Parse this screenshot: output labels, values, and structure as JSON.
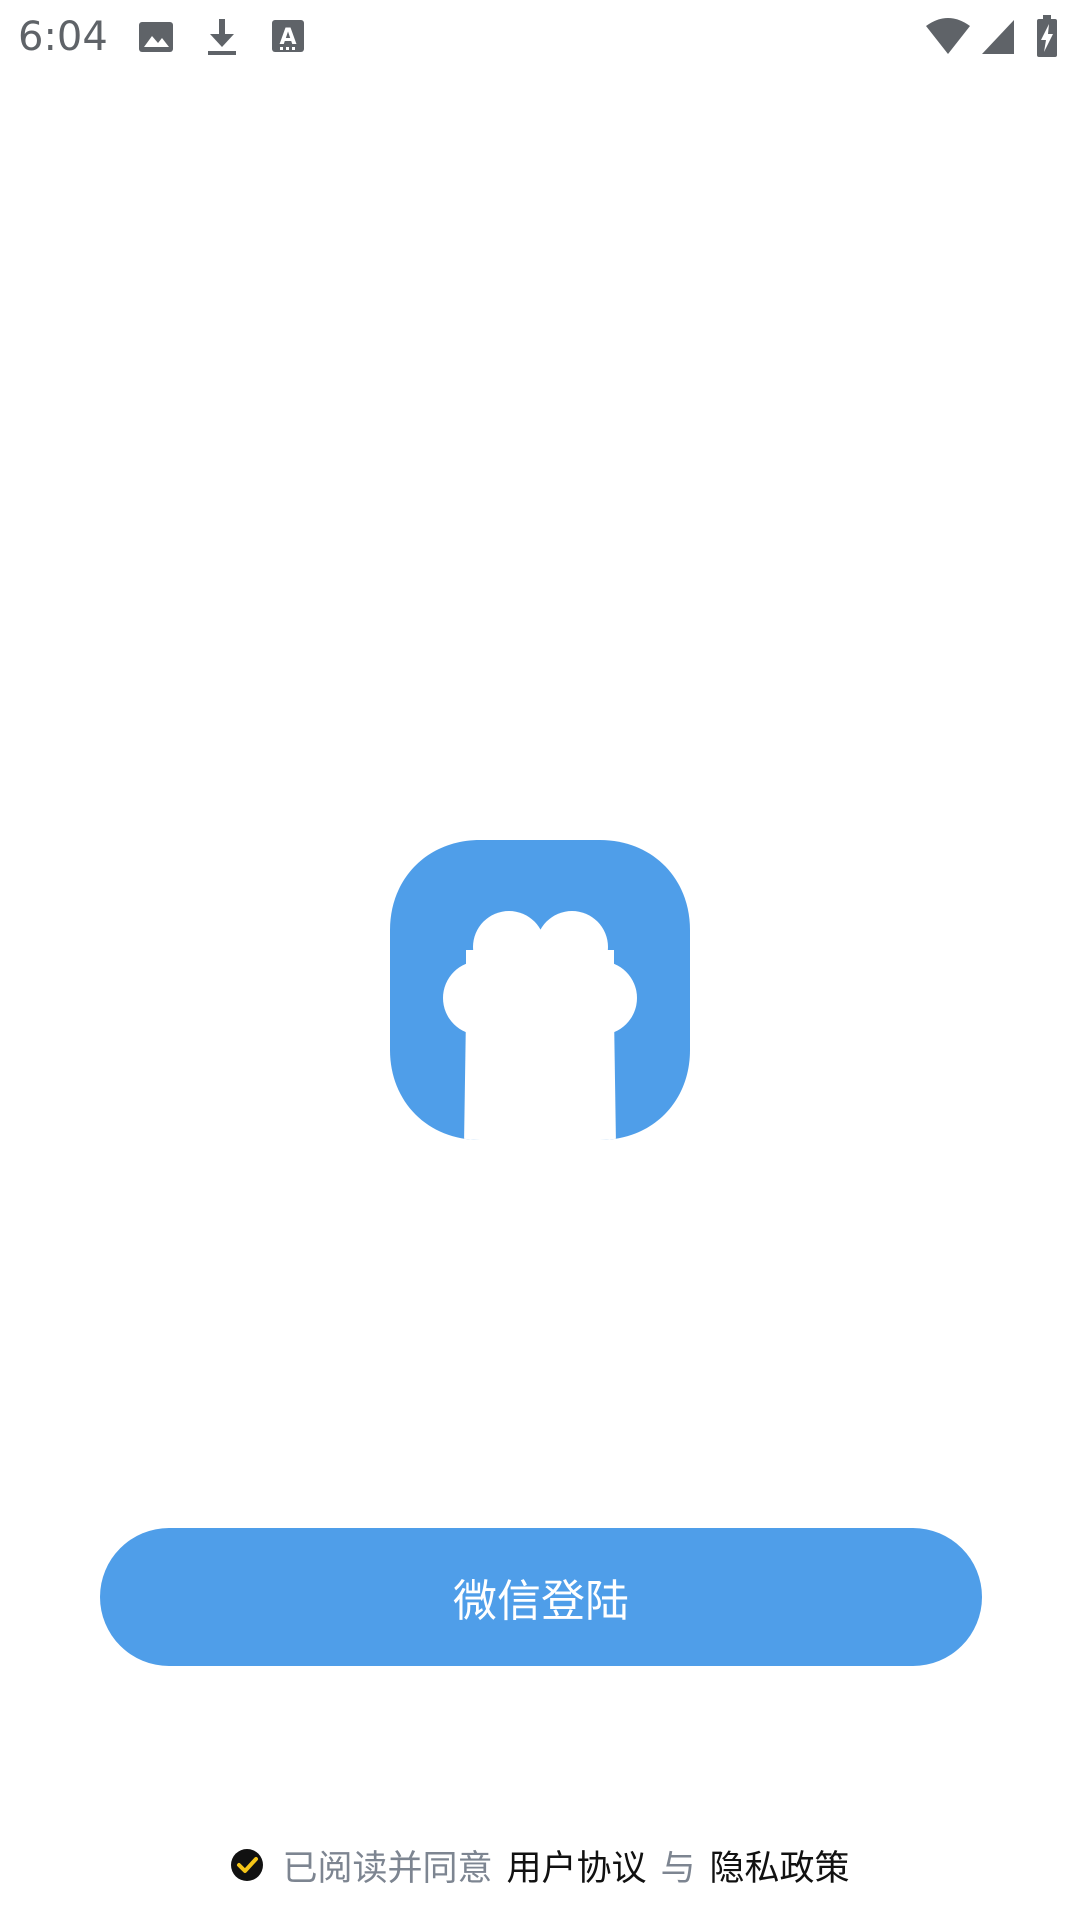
{
  "status_bar": {
    "time": "6:04",
    "icons": [
      "image-icon",
      "download-icon",
      "font-icon",
      "wifi-icon",
      "cell-signal-icon",
      "battery-charging-icon"
    ],
    "icon_color": "#5f6368"
  },
  "logo": {
    "name": "app-logo",
    "color": "#4f9ee9"
  },
  "login": {
    "button_label": "微信登陆",
    "color": "#4f9ee9"
  },
  "agreement": {
    "checked": true,
    "prefix": "已阅读并同意",
    "user_agreement": "用户协议",
    "conjunction": "与",
    "privacy_policy": "隐私政策",
    "check_color": "#f5c518"
  }
}
